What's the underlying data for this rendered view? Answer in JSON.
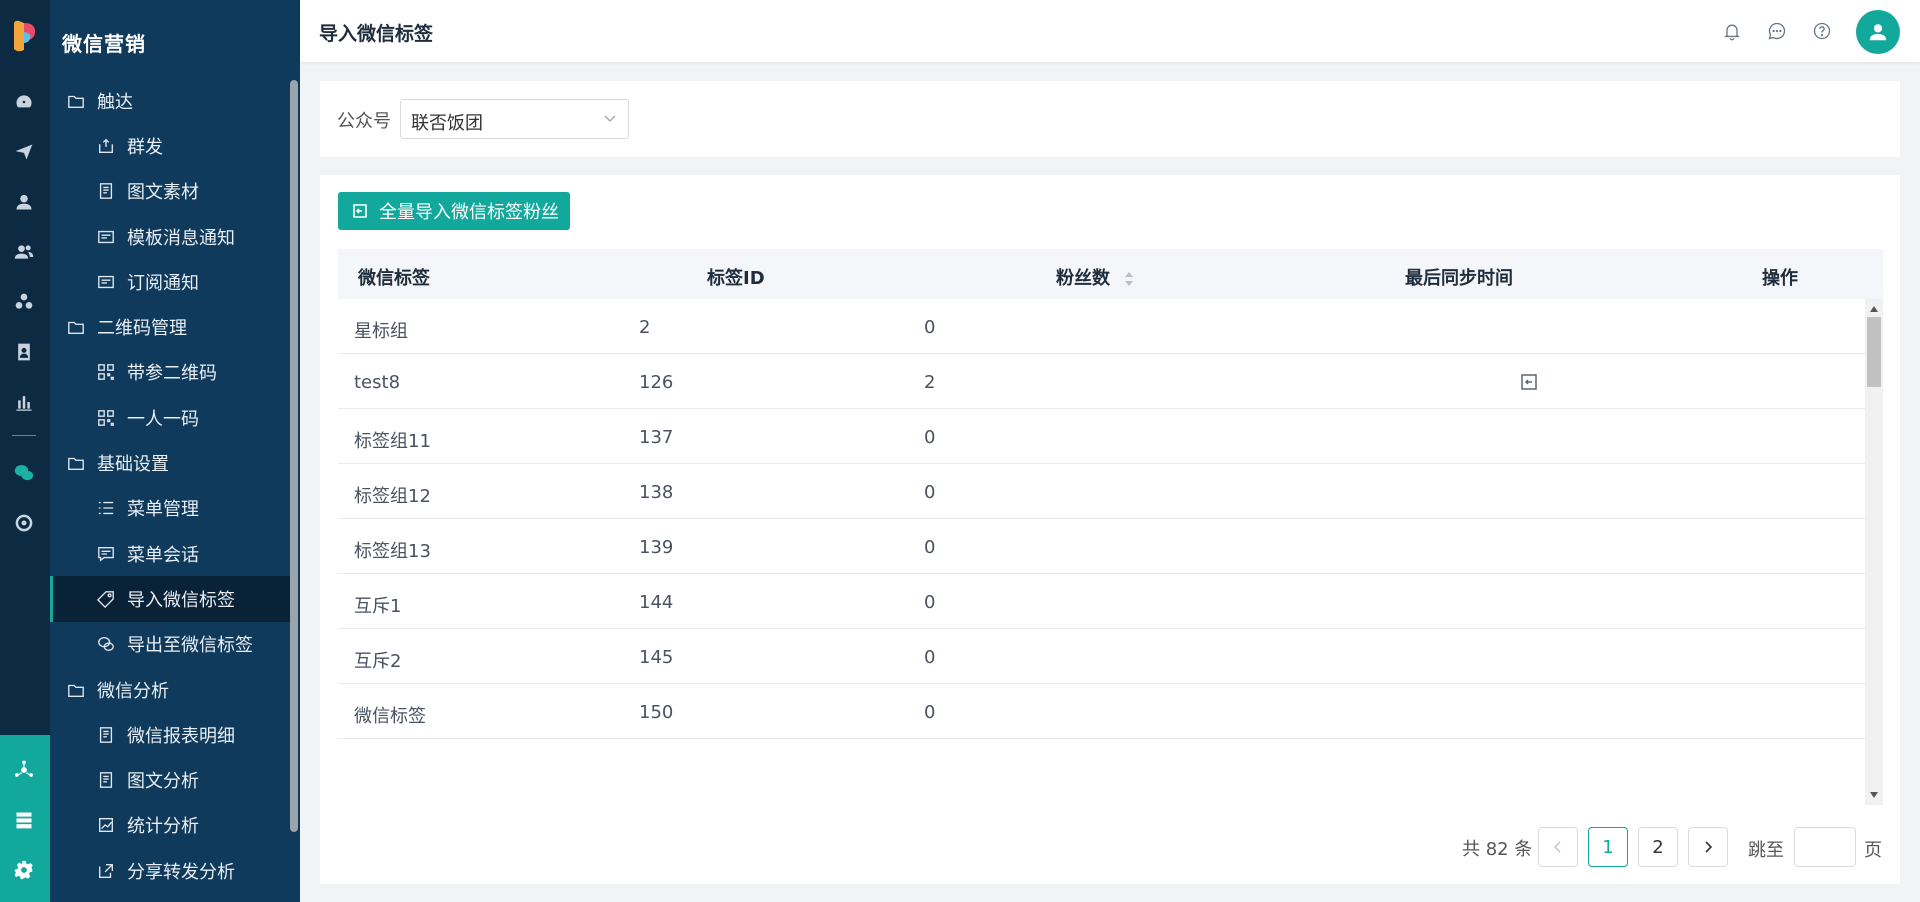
{
  "app": {
    "title": "微信营销"
  },
  "header": {
    "page_title": "导入微信标签"
  },
  "sidebar": {
    "items": [
      {
        "label": "触达",
        "type": "group",
        "icon": "folder-icon"
      },
      {
        "label": "群发",
        "type": "child",
        "icon": "broadcast-icon"
      },
      {
        "label": "图文素材",
        "type": "child",
        "icon": "article-icon"
      },
      {
        "label": "模板消息通知",
        "type": "child",
        "icon": "message-icon"
      },
      {
        "label": "订阅通知",
        "type": "child",
        "icon": "message-icon"
      },
      {
        "label": "二维码管理",
        "type": "group",
        "icon": "folder-icon"
      },
      {
        "label": "带参二维码",
        "type": "child",
        "icon": "qrcode-icon"
      },
      {
        "label": "一人一码",
        "type": "child",
        "icon": "qrcode-icon"
      },
      {
        "label": "基础设置",
        "type": "group",
        "icon": "folder-icon"
      },
      {
        "label": "菜单管理",
        "type": "child",
        "icon": "list-icon"
      },
      {
        "label": "菜单会话",
        "type": "child",
        "icon": "chat-icon"
      },
      {
        "label": "导入微信标签",
        "type": "child",
        "icon": "tag-icon",
        "active": true
      },
      {
        "label": "导出至微信标签",
        "type": "child",
        "icon": "wechat-icon"
      },
      {
        "label": "微信分析",
        "type": "group",
        "icon": "folder-icon"
      },
      {
        "label": "微信报表明细",
        "type": "child",
        "icon": "article-icon"
      },
      {
        "label": "图文分析",
        "type": "child",
        "icon": "article-icon"
      },
      {
        "label": "统计分析",
        "type": "child",
        "icon": "chart-icon"
      },
      {
        "label": "分享转发分析",
        "type": "child",
        "icon": "share-icon"
      }
    ]
  },
  "filter": {
    "label": "公众号",
    "selected": "联否饭团"
  },
  "toolbar": {
    "import_all_label": "全量导入微信标签粉丝"
  },
  "table": {
    "columns": [
      "微信标签",
      "标签ID",
      "粉丝数",
      "最后同步时间",
      "操作"
    ],
    "rows": [
      {
        "tag": "星标组",
        "id": "2",
        "fans": "0",
        "sync_time": "",
        "has_action": false
      },
      {
        "tag": "test8",
        "id": "126",
        "fans": "2",
        "sync_time": "",
        "has_action": true
      },
      {
        "tag": "标签组11",
        "id": "137",
        "fans": "0",
        "sync_time": "",
        "has_action": false
      },
      {
        "tag": "标签组12",
        "id": "138",
        "fans": "0",
        "sync_time": "",
        "has_action": false
      },
      {
        "tag": "标签组13",
        "id": "139",
        "fans": "0",
        "sync_time": "",
        "has_action": false
      },
      {
        "tag": "互斥1",
        "id": "144",
        "fans": "0",
        "sync_time": "",
        "has_action": false
      },
      {
        "tag": "互斥2",
        "id": "145",
        "fans": "0",
        "sync_time": "",
        "has_action": false
      },
      {
        "tag": "微信标签",
        "id": "150",
        "fans": "0",
        "sync_time": "",
        "has_action": false
      }
    ]
  },
  "pagination": {
    "total_text": "共 82 条",
    "pages": [
      "1",
      "2"
    ],
    "current": "1",
    "jump_label": "跳至",
    "page_unit": "页"
  },
  "colors": {
    "accent": "#12a89b",
    "sidebar_bg": "#0f3a5b",
    "rail_bg": "#0d2a43"
  }
}
